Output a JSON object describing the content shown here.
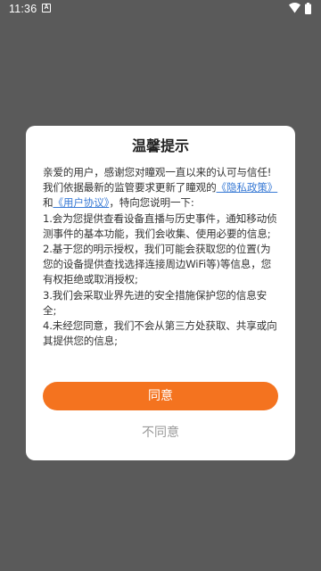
{
  "status_bar": {
    "time": "11:36",
    "notification_glyph": "A",
    "icons": [
      "wifi-icon",
      "battery-icon"
    ]
  },
  "dialog": {
    "title": "温馨提示",
    "lines": {
      "intro": "亲爱的用户，感谢您对瞳观一直以来的认可与信任!",
      "update_prefix": "我们依据最新的监管要求更新了瞳观的",
      "privacy_link": "《隐私政策》",
      "and": "和",
      "agreement_link": "《用户协议》",
      "update_suffix": "，特向您说明一下:",
      "item1": "1.会为您提供查看设备直播与历史事件，通知移动侦测事件的基本功能，我们会收集、使用必要的信息;",
      "item2": "2.基于您的明示授权，我们可能会获取您的位置(为您的设备提供查找选择连接周边WiFi等)等信息，您有权拒绝或取消授权;",
      "item3": "3.我们会采取业界先进的安全措施保护您的信息安全;",
      "item4": "4.未经您同意，我们不会从第三方处获取、共享或向其提供您的信息;"
    },
    "agree_label": "同意",
    "disagree_label": "不同意"
  },
  "colors": {
    "overlay": "#5a5a5a",
    "accent": "#f4731f",
    "link": "#3a7bd5"
  }
}
